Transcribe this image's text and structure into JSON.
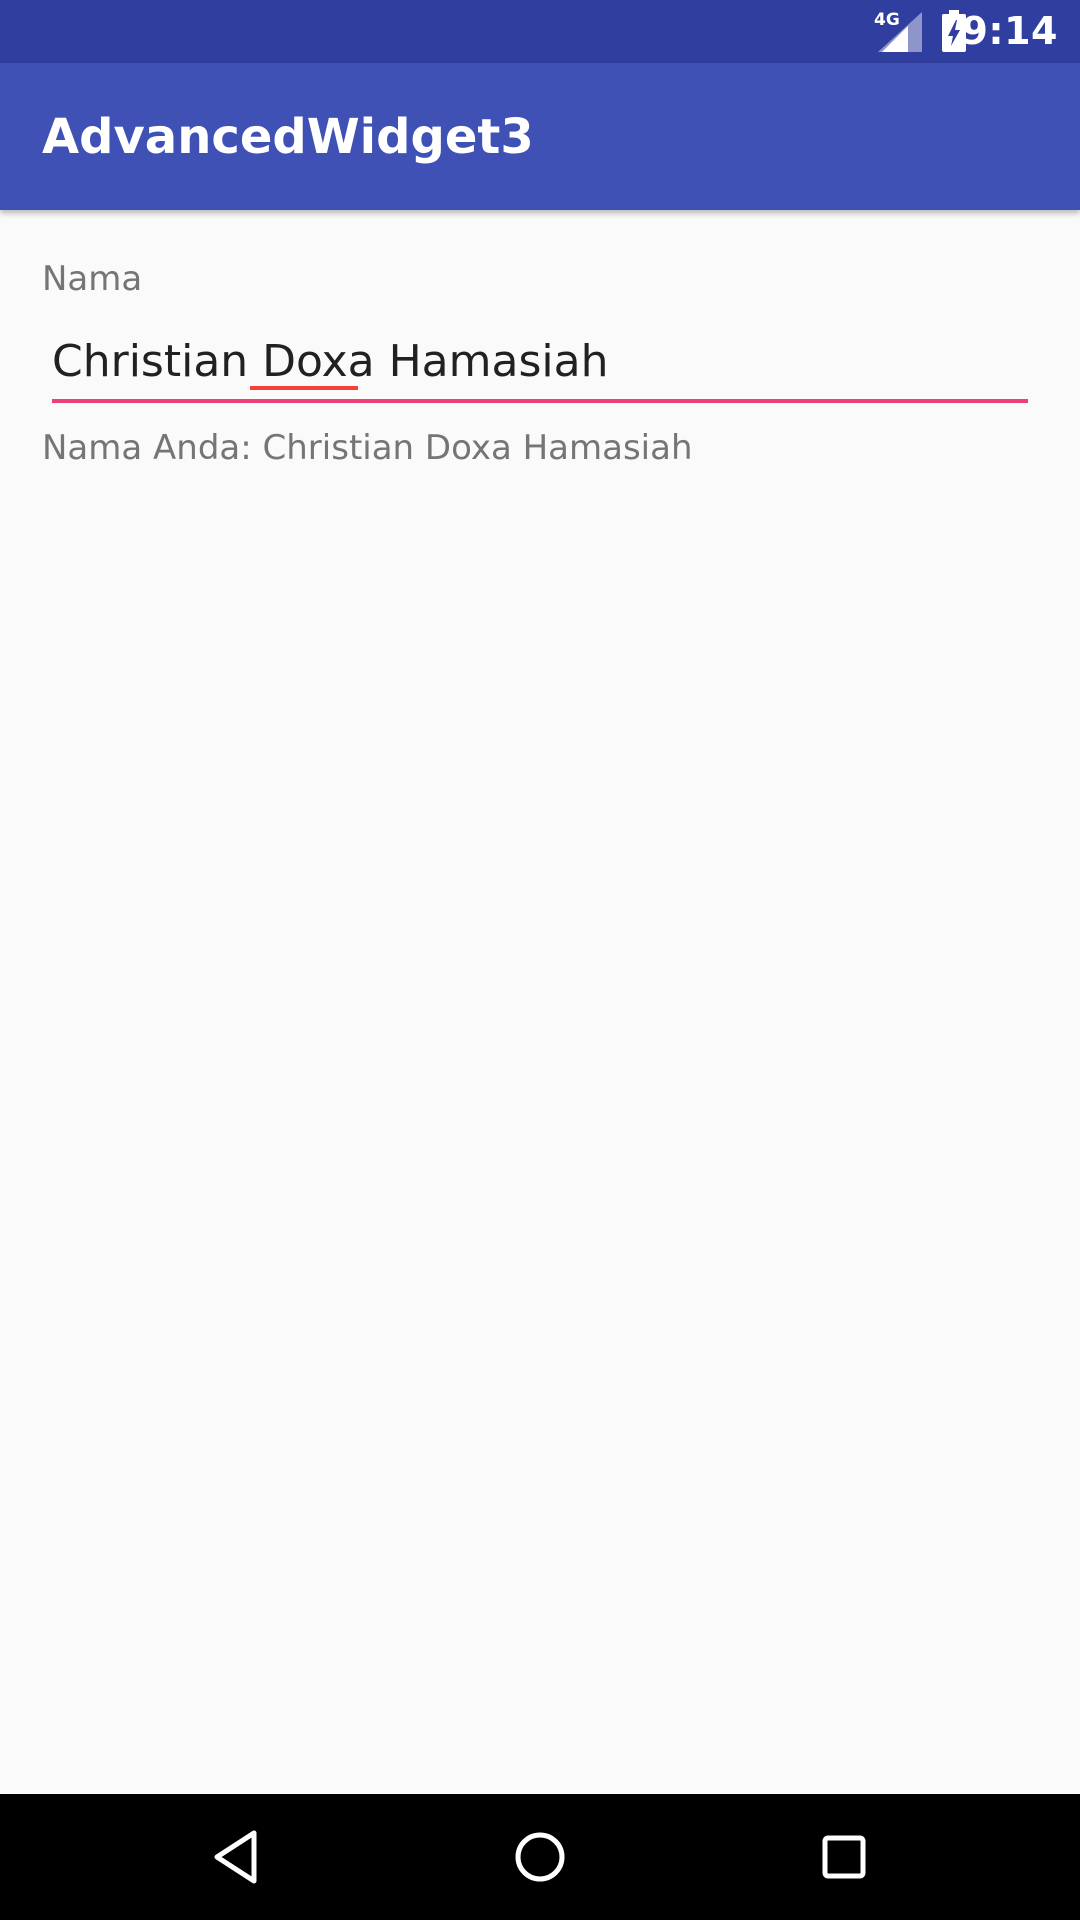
{
  "status_bar": {
    "network_label": "4G",
    "time": "9:14",
    "icons": [
      "signal-icon",
      "battery-charging-icon"
    ]
  },
  "app_bar": {
    "title": "AdvancedWidget3"
  },
  "form": {
    "label": "Nama",
    "input_value": "Christian Doxa Hamasiah",
    "output_text": "Nama Anda: Christian Doxa Hamasiah"
  },
  "nav_bar": {
    "icons": [
      "back-icon",
      "home-icon",
      "recents-icon"
    ]
  },
  "colors": {
    "status_bar": "#303f9f",
    "app_bar": "#3f51b5",
    "accent": "#ec407a",
    "spellcheck": "#f44336",
    "background": "#fafafa",
    "nav_bar": "#000000"
  }
}
